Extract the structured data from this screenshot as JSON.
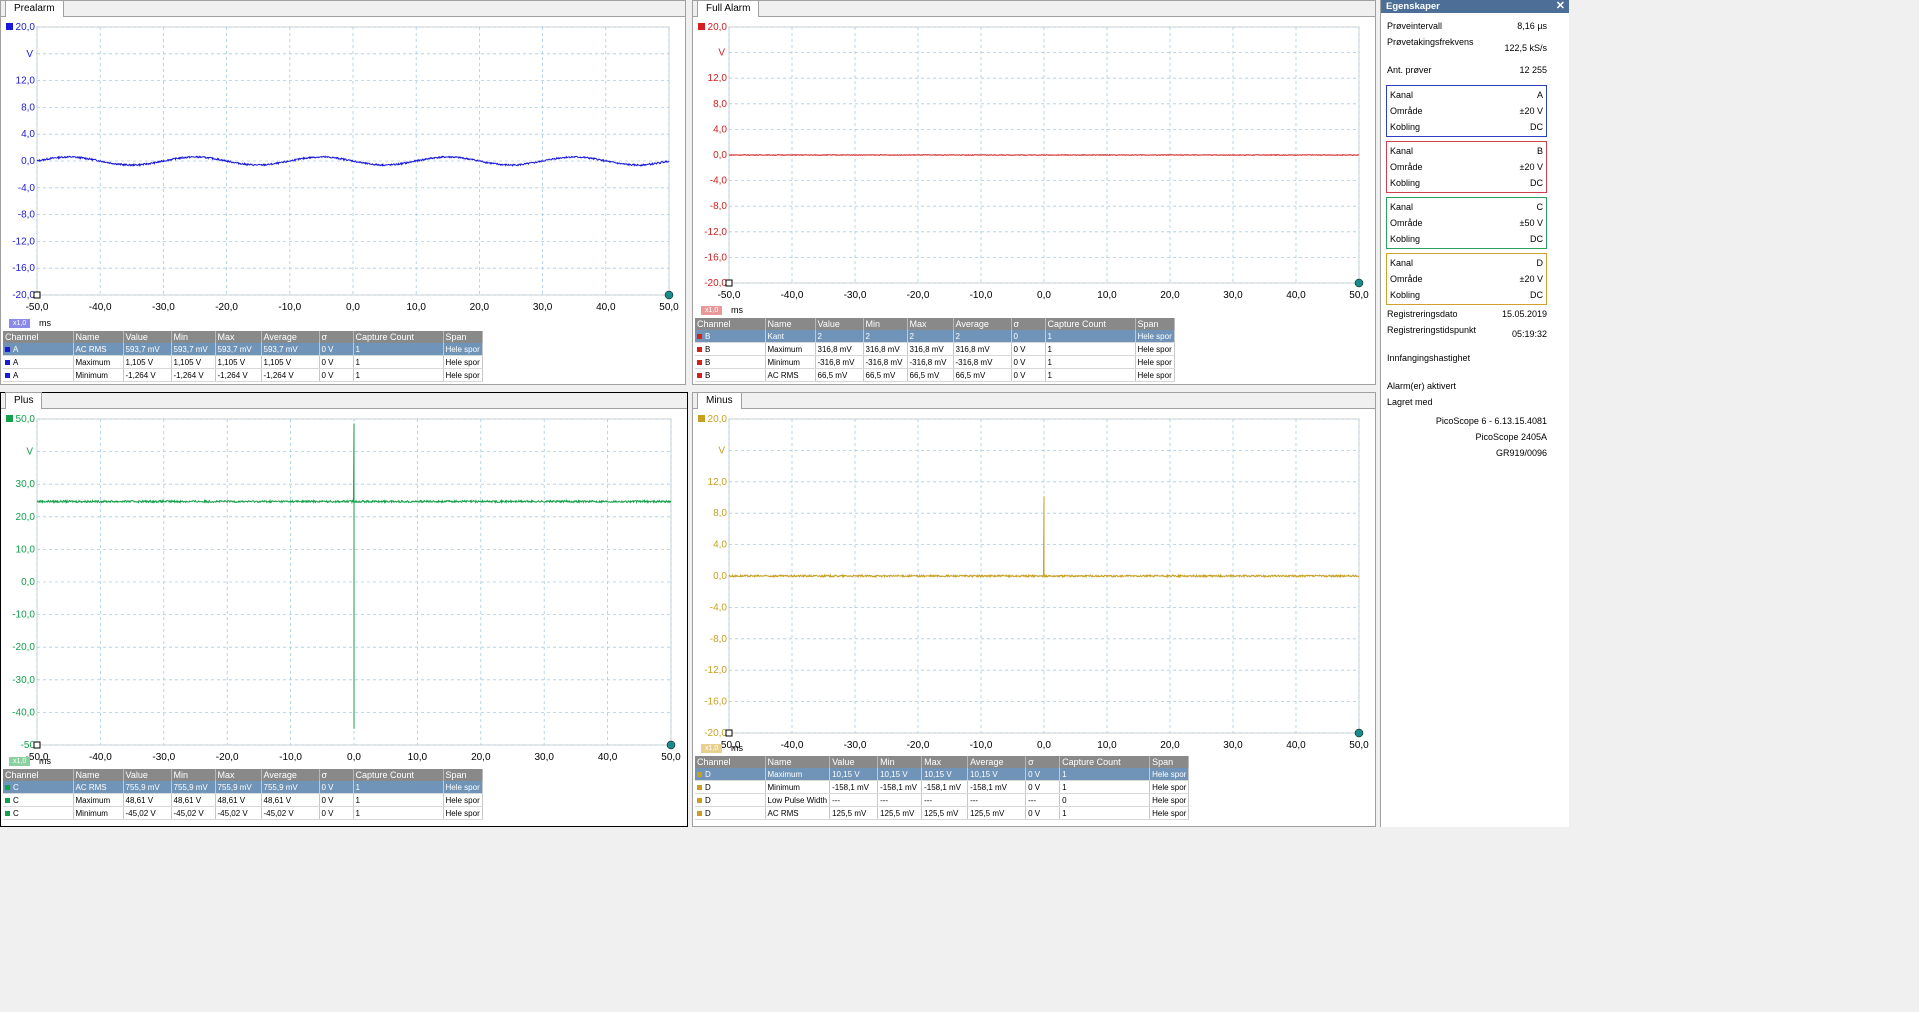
{
  "views": [
    {
      "id": "prealarm",
      "tab": "Prealarm",
      "channel": "A",
      "color": "#1a1ad8",
      "yticks": [
        "20,0",
        "12,0",
        "8,0",
        "4,0",
        "0,0",
        "-4,0",
        "-8,0",
        "-12,0",
        "-16,0",
        "-20,0"
      ],
      "yunit": "V",
      "xticks": [
        "-50,0",
        "-40,0",
        "-30,0",
        "-20,0",
        "-10,0",
        "0,0",
        "10,0",
        "20,0",
        "30,0",
        "40,0",
        "50,0"
      ],
      "xunit": "ms",
      "zoom": "x1,0",
      "zoomColor": "#8a8ae8",
      "table": {
        "headers": [
          "Channel",
          "Name",
          "Value",
          "Min",
          "Max",
          "Average",
          "σ",
          "Capture Count",
          "Span"
        ],
        "rows": [
          [
            "A",
            "AC RMS",
            "593,7 mV",
            "593,7 mV",
            "593,7 mV",
            "593,7 mV",
            "0 V",
            "1",
            "Hele spor"
          ],
          [
            "A",
            "Maximum",
            "1,105 V",
            "1,105 V",
            "1,105 V",
            "1,105 V",
            "0 V",
            "1",
            "Hele spor"
          ],
          [
            "A",
            "Minimum",
            "-1,264 V",
            "-1,264 V",
            "-1,264 V",
            "-1,264 V",
            "0 V",
            "1",
            "Hele spor"
          ]
        ]
      }
    },
    {
      "id": "fullalarm",
      "tab": "Full Alarm",
      "channel": "B",
      "color": "#d42020",
      "yticks": [
        "20,0",
        "12,0",
        "8,0",
        "4,0",
        "0,0",
        "-4,0",
        "-8,0",
        "-12,0",
        "-16,0",
        "-20,0"
      ],
      "yunit": "V",
      "xticks": [
        "-50,0",
        "-40,0",
        "-30,0",
        "-20,0",
        "-10,0",
        "0,0",
        "10,0",
        "20,0",
        "30,0",
        "40,0",
        "50,0"
      ],
      "xunit": "ms",
      "zoom": "x1,0",
      "zoomColor": "#e89a9a",
      "table": {
        "headers": [
          "Channel",
          "Name",
          "Value",
          "Min",
          "Max",
          "Average",
          "σ",
          "Capture Count",
          "Span"
        ],
        "rows": [
          [
            "B",
            "Kant",
            "2",
            "2",
            "2",
            "2",
            "0",
            "1",
            "Hele spor"
          ],
          [
            "B",
            "Maximum",
            "316,8 mV",
            "316,8 mV",
            "316,8 mV",
            "316,8 mV",
            "0 V",
            "1",
            "Hele spor"
          ],
          [
            "B",
            "Minimum",
            "-316,8 mV",
            "-316,8 mV",
            "-316,8 mV",
            "-316,8 mV",
            "0 V",
            "1",
            "Hele spor"
          ],
          [
            "B",
            "AC RMS",
            "66,5 mV",
            "66,5 mV",
            "66,5 mV",
            "66,5 mV",
            "0 V",
            "1",
            "Hele spor"
          ]
        ]
      }
    },
    {
      "id": "plus",
      "tab": "Plus",
      "channel": "C",
      "color": "#12a04a",
      "yticks": [
        "50,0",
        "30,0",
        "20,0",
        "10,0",
        "0,0",
        "-10,0",
        "-20,0",
        "-30,0",
        "-40,0",
        "-50"
      ],
      "yunit": "V",
      "xticks": [
        "-50,0",
        "-40,0",
        "-30,0",
        "-20,0",
        "-10,0",
        "0,0",
        "10,0",
        "20,0",
        "30,0",
        "40,0",
        "50,0"
      ],
      "xunit": "ms",
      "zoom": "x1,0",
      "zoomColor": "#8ad0a0",
      "table": {
        "headers": [
          "Channel",
          "Name",
          "Value",
          "Min",
          "Max",
          "Average",
          "σ",
          "Capture Count",
          "Span"
        ],
        "rows": [
          [
            "C",
            "AC RMS",
            "755,9 mV",
            "755,9 mV",
            "755,9 mV",
            "755,9 mV",
            "0 V",
            "1",
            "Hele spor"
          ],
          [
            "C",
            "Maximum",
            "48,61 V",
            "48,61 V",
            "48,61 V",
            "48,61 V",
            "0 V",
            "1",
            "Hele spor"
          ],
          [
            "C",
            "Minimum",
            "-45,02 V",
            "-45,02 V",
            "-45,02 V",
            "-45,02 V",
            "0 V",
            "1",
            "Hele spor"
          ]
        ]
      }
    },
    {
      "id": "minus",
      "tab": "Minus",
      "channel": "D",
      "color": "#c8a020",
      "yticks": [
        "20,0",
        "12,0",
        "8,0",
        "4,0",
        "0,0",
        "-4,0",
        "-8,0",
        "-12,0",
        "-16,0",
        "-20,0"
      ],
      "yunit": "V",
      "xticks": [
        "-50,0",
        "-40,0",
        "-30,0",
        "-20,0",
        "-10,0",
        "0,0",
        "10,0",
        "20,0",
        "30,0",
        "40,0",
        "50,0"
      ],
      "xunit": "ms",
      "zoom": "x1,0",
      "zoomColor": "#e8d090",
      "table": {
        "headers": [
          "Channel",
          "Name",
          "Value",
          "Min",
          "Max",
          "Average",
          "σ",
          "Capture Count",
          "Span"
        ],
        "rows": [
          [
            "D",
            "Maximum",
            "10,15 V",
            "10,15 V",
            "10,15 V",
            "10,15 V",
            "0 V",
            "1",
            "Hele spor"
          ],
          [
            "D",
            "Minimum",
            "-158,1 mV",
            "-158,1 mV",
            "-158,1 mV",
            "-158,1 mV",
            "0 V",
            "1",
            "Hele spor"
          ],
          [
            "D",
            "Low Pulse Width",
            "---",
            "---",
            "---",
            "---",
            "---",
            "0",
            "Hele spor"
          ],
          [
            "D",
            "AC RMS",
            "125,5 mV",
            "125,5 mV",
            "125,5 mV",
            "125,5 mV",
            "0 V",
            "1",
            "Hele spor"
          ]
        ]
      }
    }
  ],
  "properties": {
    "title": "Egenskaper",
    "close": "✕",
    "sample_interval_label": "Prøveintervall",
    "sample_interval": "8,16 µs",
    "sample_rate_label": "Prøvetakingsfrekvens",
    "sample_rate": "122,5 kS/s",
    "samples_label": "Ant. prøver",
    "samples": "12 255",
    "channels": [
      {
        "kanal_label": "Kanal",
        "kanal": "A",
        "range_label": "Område",
        "range": "±20 V",
        "coupling_label": "Kobling",
        "coupling": "DC",
        "color": "#2b3fbf"
      },
      {
        "kanal_label": "Kanal",
        "kanal": "B",
        "range_label": "Område",
        "range": "±20 V",
        "coupling_label": "Kobling",
        "coupling": "DC",
        "color": "#d04050"
      },
      {
        "kanal_label": "Kanal",
        "kanal": "C",
        "range_label": "Område",
        "range": "±50 V",
        "coupling_label": "Kobling",
        "coupling": "DC",
        "color": "#2aa060"
      },
      {
        "kanal_label": "Kanal",
        "kanal": "D",
        "range_label": "Område",
        "range": "±20 V",
        "coupling_label": "Kobling",
        "coupling": "DC",
        "color": "#d0a030"
      }
    ],
    "reg_date_label": "Registreringsdato",
    "reg_date": "15.05.2019",
    "reg_time_label": "Registreringstidspunkt",
    "reg_time": "05:19:32",
    "capture_speed_label": "Innfangingshastighet",
    "alarms_label": "Alarm(er) aktivert",
    "saved_with_label": "Lagret med",
    "software": "PicoScope 6 - 6.13.15.4081",
    "device": "PicoScope 2405A",
    "serial": "GR919/0096"
  },
  "traces": {
    "prealarm": {
      "type": "sine",
      "amplitude": 0.6,
      "cycles": 5,
      "noise": 0.12
    },
    "fullalarm": {
      "type": "flat",
      "level": 0.0,
      "noise": 0.05
    },
    "plus": {
      "type": "flat_spike",
      "level": 24.7,
      "spike_at": 0.0,
      "spike_max": 48.61,
      "spike_min": -45.02
    },
    "minus": {
      "type": "flat_spike",
      "level": 0.0,
      "spike_at": 0.0,
      "spike_max": 10.15,
      "spike_min": -0.158
    }
  }
}
